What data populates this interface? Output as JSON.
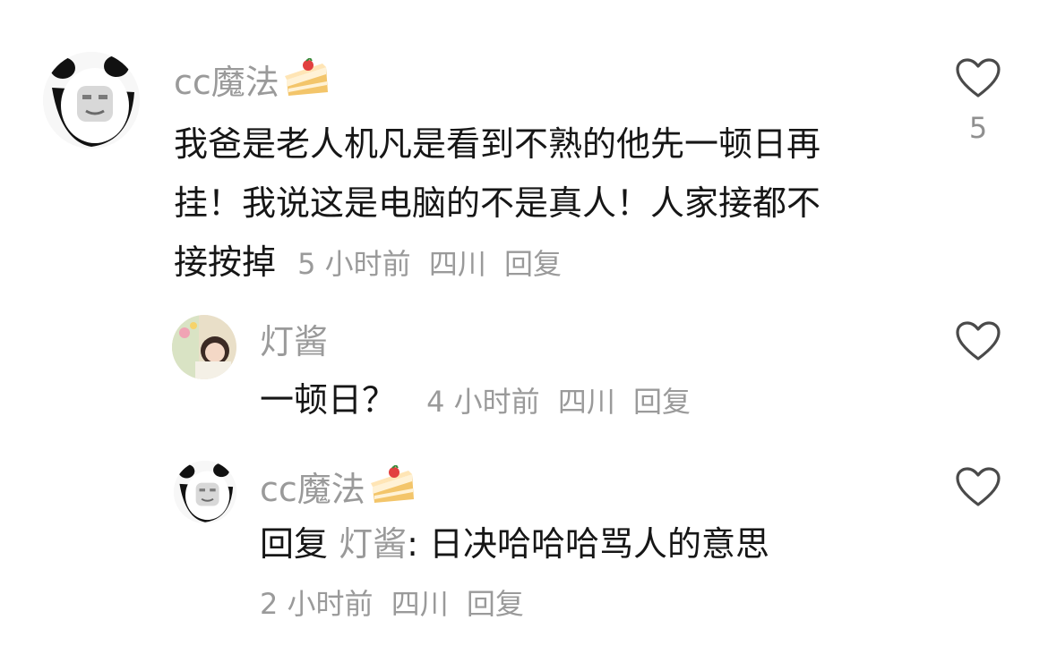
{
  "comments": [
    {
      "username": "cc魔法",
      "badge_icon": "cake-icon",
      "text_lines": [
        "我爸是老人机凡是看到不熟的他先一顿日再",
        "挂！我说这是电脑的不是真人！人家接都不",
        "接按掉"
      ],
      "time": "5 小时前",
      "location": "四川",
      "reply_label": "回复",
      "like_count": "5"
    },
    {
      "username": "灯酱",
      "text": "一顿日？",
      "time": "4 小时前",
      "location": "四川",
      "reply_label": "回复"
    },
    {
      "username": "cc魔法",
      "badge_icon": "cake-icon",
      "reply_prefix": "回复",
      "reply_to": "灯酱",
      "colon": ":",
      "text": " 日决哈哈哈骂人的意思",
      "time": "2 小时前",
      "location": "四川",
      "reply_label": "回复"
    }
  ],
  "colors": {
    "text": "#161616",
    "secondary": "#9a9a9a",
    "heart_outline": "#4a4a4a"
  }
}
